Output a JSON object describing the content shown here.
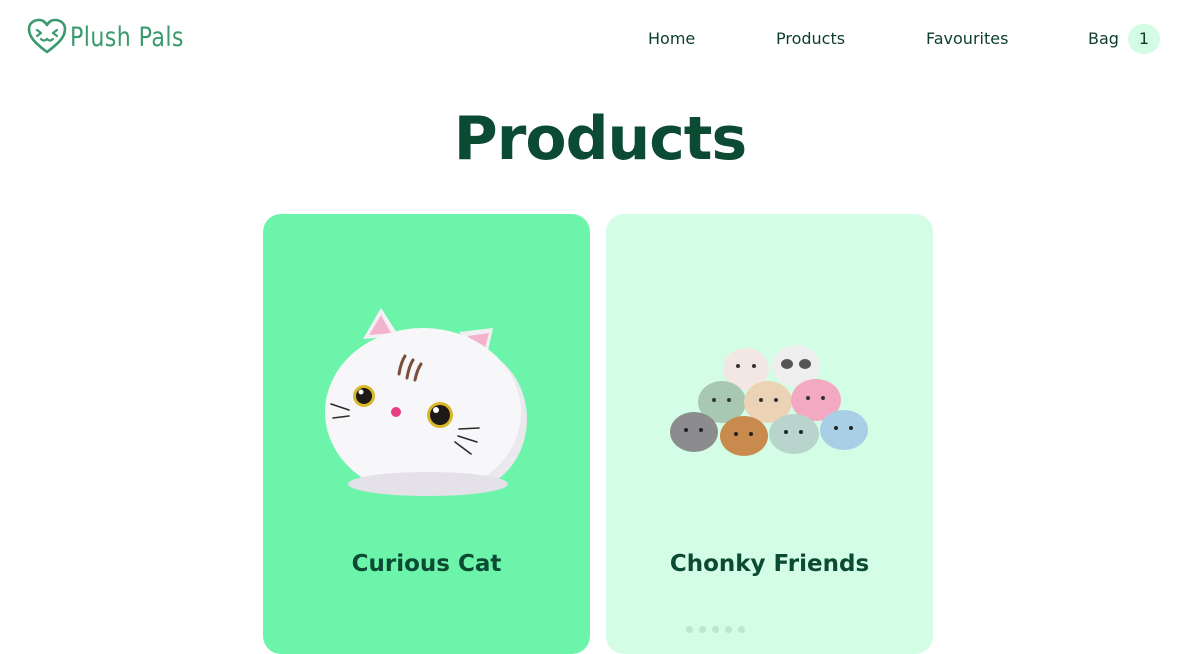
{
  "brand": {
    "name": "Plush Pals",
    "logo_icon": "heart-face-icon",
    "color": "#3a9a6e"
  },
  "nav": {
    "home": "Home",
    "products": "Products",
    "favourites": "Favourites",
    "bag": "Bag",
    "bag_count": "1"
  },
  "page": {
    "title": "Products"
  },
  "products": [
    {
      "name": "Curious Cat",
      "card_color": "#6cf4aa",
      "image": "white-cat-plush"
    },
    {
      "name": "Chonky Friends",
      "card_color": "#d3fde5",
      "image": "animal-plush-pile"
    }
  ],
  "colors": {
    "title": "#0b4a33",
    "badge_bg": "#d4fbe4"
  }
}
